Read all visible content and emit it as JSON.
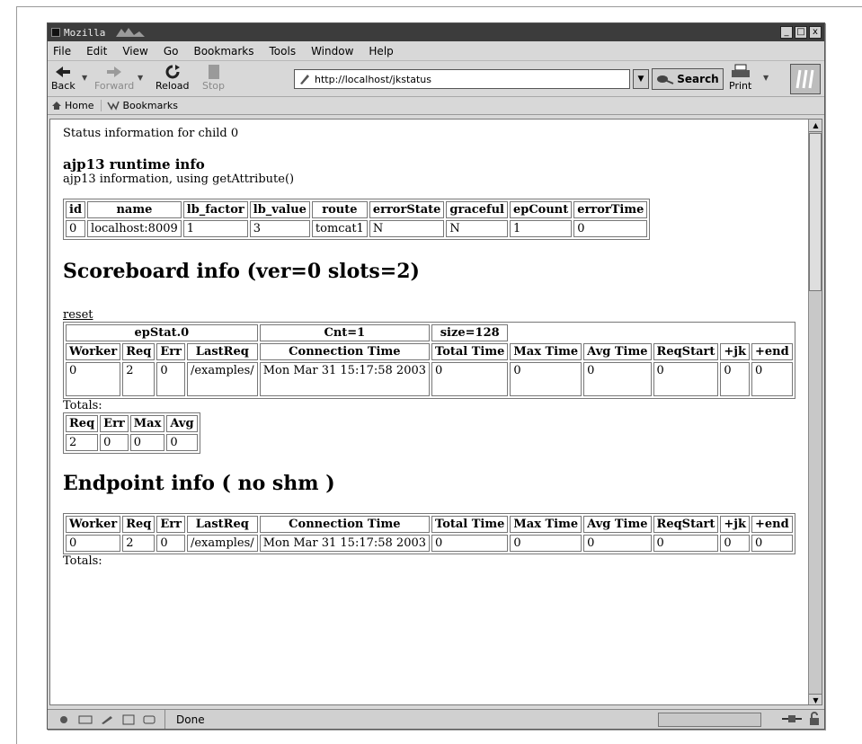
{
  "window": {
    "title": "Mozilla",
    "buttons": [
      "_",
      "□",
      "x"
    ]
  },
  "menubar": {
    "items": [
      "File",
      "Edit",
      "View",
      "Go",
      "Bookmarks",
      "Tools",
      "Window",
      "Help"
    ]
  },
  "toolbar": {
    "back": "Back",
    "forward": "Forward",
    "reload": "Reload",
    "stop": "Stop",
    "url": "http://localhost/jkstatus",
    "search": "Search",
    "print": "Print"
  },
  "personal_bar": {
    "home": "Home",
    "bookmarks": "Bookmarks"
  },
  "page": {
    "status_line": "Status information for child 0",
    "runtime_heading": "ajp13 runtime info",
    "ajp_info": "ajp13 information, using getAttribute()",
    "runtime_table": {
      "headers": [
        "id",
        "name",
        "lb_factor",
        "lb_value",
        "route",
        "errorState",
        "graceful",
        "epCount",
        "errorTime"
      ],
      "rows": [
        [
          "0",
          "localhost:8009",
          "1",
          "3",
          "tomcat1",
          "N",
          "N",
          "1",
          "0"
        ]
      ]
    },
    "scoreboard_heading": "Scoreboard info (ver=0 slots=2)",
    "reset_link": "reset",
    "scoreboard_table": {
      "group_headers": [
        "epStat.0",
        "Cnt=1",
        "size=128"
      ],
      "headers": [
        "Worker",
        "Req",
        "Err",
        "LastReq",
        "Connection Time",
        "Total Time",
        "Max Time",
        "Avg Time",
        "ReqStart",
        "+jk",
        "+end"
      ],
      "rows": [
        [
          "0",
          "2",
          "0",
          "/examples/",
          "Mon Mar 31 15:17:58 2003",
          "0",
          "0",
          "0",
          "0",
          "0",
          "0"
        ]
      ]
    },
    "totals_label": "Totals:",
    "totals_table": {
      "headers": [
        "Req",
        "Err",
        "Max",
        "Avg"
      ],
      "rows": [
        [
          "2",
          "0",
          "0",
          "0"
        ]
      ]
    },
    "endpoint_heading": "Endpoint info ( no shm )",
    "endpoint_table": {
      "headers": [
        "Worker",
        "Req",
        "Err",
        "LastReq",
        "Connection Time",
        "Total Time",
        "Max Time",
        "Avg Time",
        "ReqStart",
        "+jk",
        "+end"
      ],
      "rows": [
        [
          "0",
          "2",
          "0",
          "/examples/",
          "Mon Mar 31 15:17:58 2003",
          "0",
          "0",
          "0",
          "0",
          "0",
          "0"
        ]
      ]
    },
    "totals_label_2": "Totals:"
  },
  "statusbar": {
    "text": "Done"
  }
}
